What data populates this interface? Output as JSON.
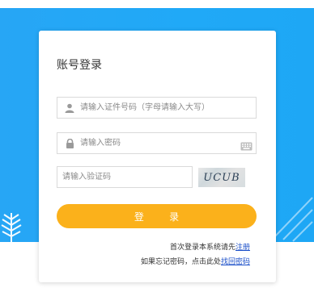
{
  "colors": {
    "background": "#22a8f6",
    "button": "#fbb11b",
    "link": "#1a4ec8"
  },
  "title": "账号登录",
  "id_field": {
    "icon": "user-icon",
    "placeholder": "请输入证件号码（字母请输入大写）"
  },
  "password_field": {
    "icon": "lock-icon",
    "placeholder": "请输入密码",
    "keyboard_icon": "keyboard-icon"
  },
  "captcha": {
    "placeholder": "请输入验证码",
    "image_text": "UCUB"
  },
  "login_button": "登 录",
  "first_login": {
    "text": "首次登录本系统请先",
    "link": "注册"
  },
  "forgot": {
    "text": "如果忘记密码，点击此处",
    "link": "找回密码"
  }
}
